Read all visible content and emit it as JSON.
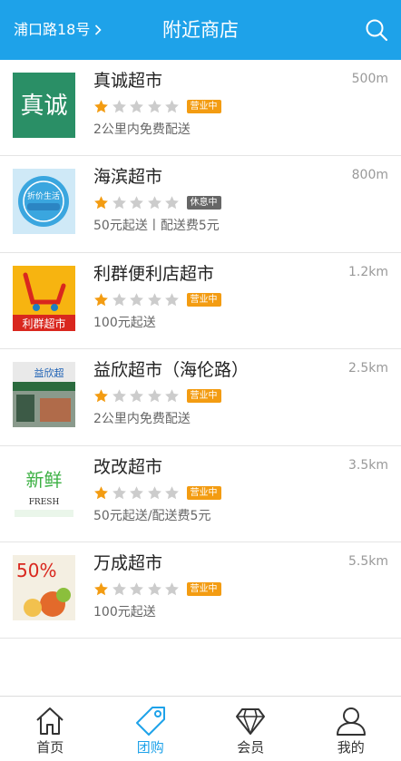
{
  "header": {
    "location": "浦口路18号",
    "title": "附近商店"
  },
  "stores": [
    {
      "name": "真诚超市",
      "distance": "500m",
      "rating": 1,
      "status": "营业中",
      "status_color": "#f39c12",
      "note": "2公里内免费配送",
      "logo_text": "真诚"
    },
    {
      "name": "海滨超市",
      "distance": "800m",
      "rating": 1,
      "status": "休息中",
      "status_color": "#666666",
      "note": "50元起送丨配送费5元",
      "logo_text": "折价生活"
    },
    {
      "name": "利群便利店超市",
      "distance": "1.2km",
      "rating": 1,
      "status": "营业中",
      "status_color": "#f39c12",
      "note": "100元起送",
      "logo_text": "利群超市"
    },
    {
      "name": "益欣超市（海伦路）",
      "distance": "2.5km",
      "rating": 1,
      "status": "营业中",
      "status_color": "#f39c12",
      "note": "2公里内免费配送",
      "logo_text": "益欣超"
    },
    {
      "name": "改改超市",
      "distance": "3.5km",
      "rating": 1,
      "status": "营业中",
      "status_color": "#f39c12",
      "note": "50元起送/配送费5元",
      "logo_text": "新鲜"
    },
    {
      "name": "万成超市",
      "distance": "5.5km",
      "rating": 1,
      "status": "营业中",
      "status_color": "#f39c12",
      "note": "100元起送",
      "logo_text": "50%"
    }
  ],
  "tabs": [
    {
      "label": "首页",
      "icon": "home-icon",
      "active": false
    },
    {
      "label": "团购",
      "icon": "tag-icon",
      "active": true
    },
    {
      "label": "会员",
      "icon": "diamond-icon",
      "active": false
    },
    {
      "label": "我的",
      "icon": "user-icon",
      "active": false
    }
  ],
  "colors": {
    "accent": "#1ea2e9",
    "star_on": "#f39c12",
    "star_off": "#cccccc"
  }
}
